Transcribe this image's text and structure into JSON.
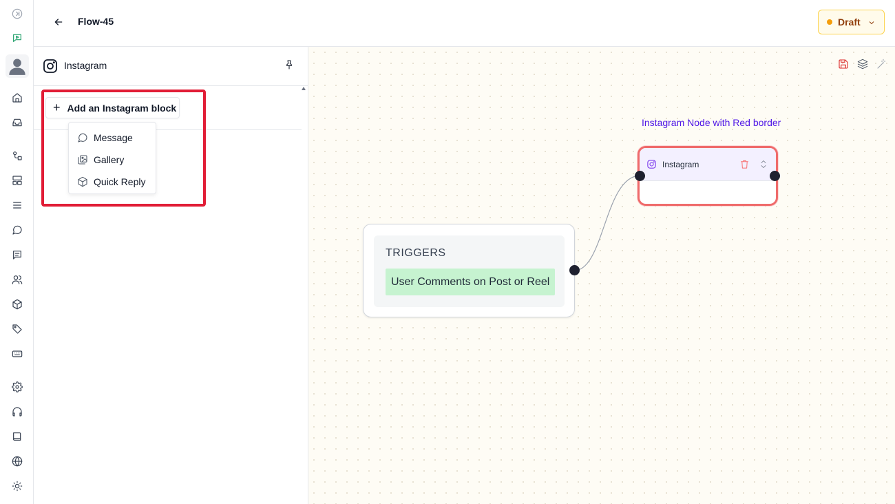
{
  "header": {
    "flow_title": "Flow-45",
    "status_label": "Draft"
  },
  "panel": {
    "title": "Instagram",
    "add_block_label": "Add an Instagram block",
    "menu_items": [
      {
        "label": "Message",
        "icon": "message-circle-icon"
      },
      {
        "label": "Gallery",
        "icon": "gallery-icon"
      },
      {
        "label": "Quick Reply",
        "icon": "box-icon"
      }
    ]
  },
  "canvas": {
    "annotation": "Instagram Node with Red border",
    "trigger_node": {
      "title": "TRIGGERS",
      "chip": "User Comments on Post or Reel"
    },
    "instagram_node": {
      "title": "Instagram"
    }
  },
  "colors": {
    "highlight": "#e11d36",
    "node_border": "#ef6b6b",
    "annotation": "#4f16e6",
    "trigger_chip": "#c6f3d0",
    "draft_accent": "#f59e0b"
  }
}
